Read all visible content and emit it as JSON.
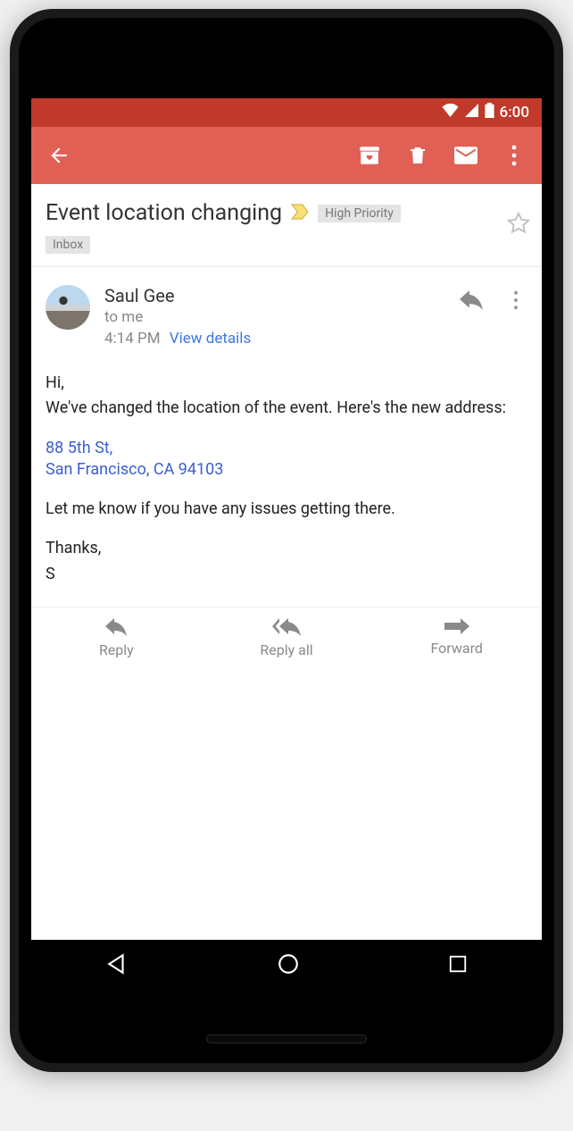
{
  "statusbar": {
    "time": "6:00"
  },
  "email": {
    "subject": "Event location changing",
    "priority_label": "High Priority",
    "folder_label": "Inbox",
    "sender_name": "Saul Gee",
    "recipient_line": "to me",
    "time": "4:14 PM",
    "view_details": "View details",
    "body": {
      "greeting": "Hi,",
      "line1": "We've changed the location of the event. Here's the new address:",
      "address_line1": "88 5th St,",
      "address_line2": "San Francisco, CA 94103",
      "line2": "Let me know if you have any issues getting there.",
      "signoff1": "Thanks,",
      "signoff2": "S"
    }
  },
  "actions": {
    "reply": "Reply",
    "reply_all": "Reply all",
    "forward": "Forward"
  }
}
